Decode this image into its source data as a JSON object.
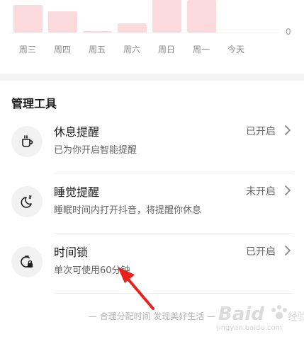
{
  "chart_data": {
    "type": "bar",
    "categories": [
      "周三",
      "周四",
      "周五",
      "周六",
      "周日",
      "周一",
      "今天"
    ],
    "values": [
      39,
      30,
      2,
      13,
      48,
      46,
      0
    ],
    "ylim": [
      0,
      48
    ],
    "y_tick_labels": [
      "0"
    ],
    "bar_color": "#fadadd"
  },
  "section": {
    "title": "管理工具"
  },
  "tools": [
    {
      "title": "休息提醒",
      "desc": "已为你开启智能提醒",
      "status": "已开启",
      "icon": "cup-icon"
    },
    {
      "title": "睡觉提醒",
      "desc": "睡眠时间内打开抖音，将提醒你休息",
      "status": "未开启",
      "icon": "moon-icon"
    },
    {
      "title": "时间锁",
      "desc": "单次可使用60分钟",
      "status": "已开启",
      "icon": "timer-lock-icon"
    }
  ],
  "footer": {
    "text": "— 合理分配时间 发现美好生活 —"
  },
  "watermark": {
    "text": "jingyan.baidu.com"
  },
  "colors": {
    "annotation_arrow": "#e8211d",
    "bar": "#fadadd"
  }
}
